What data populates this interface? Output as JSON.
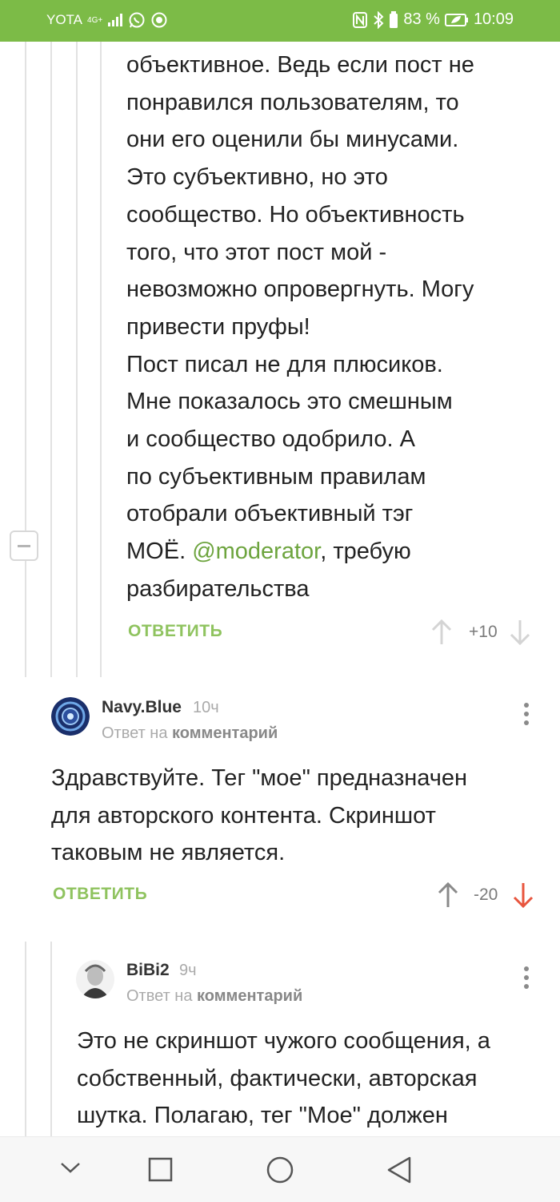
{
  "status_bar": {
    "carrier": "YOTA",
    "network": "4G+",
    "battery": "83 %",
    "time": "10:09",
    "icons": [
      "signal-icon",
      "whatsapp-icon",
      "media-icon",
      "nfc-icon",
      "bluetooth-icon",
      "battery-icon",
      "power-saving-icon"
    ]
  },
  "comment_1": {
    "lines": [
      "объективное. Ведь если пост не",
      "понравился пользователям, то",
      "они его оценили бы минусами.",
      "Это субъективно, но это",
      "сообщество. Но объективность",
      "того, что этот пост мой -",
      "невозможно опровергнуть. Могу",
      "привести пруфы!",
      "Пост писал не для плюсиков.",
      "Мне показалось это смешным",
      "и сообщество одобрило. А",
      "по субъективным правилам",
      "отобрали объективный тэг"
    ],
    "line_mention_prefix": "МОЁ. ",
    "mention": "@moderator",
    "line_mention_suffix": ", требую",
    "last_line": "разбирательства",
    "reply_label": "ОТВЕТИТЬ",
    "score": "+10"
  },
  "comment_2": {
    "username": "Navy.Blue",
    "time": "10ч",
    "reply_to_prefix": "Ответ на ",
    "reply_to_target": "комментарий",
    "lines": [
      "Здравствуйте. Тег \"мое\" предназначен",
      "для авторского контента. Скриншот",
      "таковым не является."
    ],
    "reply_label": "ОТВЕТИТЬ",
    "score": "-20",
    "downvote_color": "#e8553e"
  },
  "comment_3": {
    "username": "BiBi2",
    "time": "9ч",
    "reply_to_prefix": "Ответ на ",
    "reply_to_target": "комментарий",
    "lines": [
      "Это не скриншот чужого сообщения, а",
      "собственный, фактически, авторская",
      "шутка. Полагаю, тег \"Мое\" должен"
    ]
  },
  "colors": {
    "accent": "#7cbb47",
    "reply_link": "#8fc35f",
    "mention": "#6da43e"
  }
}
